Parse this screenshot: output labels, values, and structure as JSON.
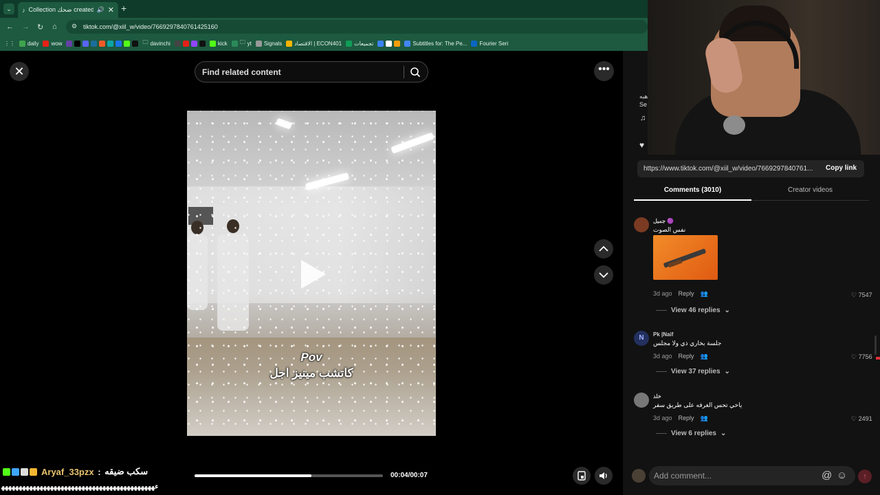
{
  "browser": {
    "tab_title": "Collection ضحك created by",
    "url": "tiktok.com/@xiil_w/video/7669297840761425160",
    "bookmarks": [
      "daily",
      "wow",
      "davinchi",
      "kick",
      "yt",
      "Signals",
      "الاقتصاد | ECON401",
      "تجميعات",
      "Subtitles for: The Pe...",
      "Fourier Seri"
    ]
  },
  "search": {
    "placeholder": "Find related content"
  },
  "video": {
    "caption_line1": "Pov",
    "caption_line2": "كاتشب مينيز اجل",
    "timecode": "00:04/00:07",
    "progress": 0.62
  },
  "panel": {
    "partial_author_fragment": "هبه",
    "partial_sub_fragment": "Se",
    "share_url": "https://www.tiktok.com/@xiil_w/video/7669297840761...",
    "copy_link": "Copy link",
    "tabs": {
      "comments": "Comments (3010)",
      "creator": "Creator videos"
    }
  },
  "comments": [
    {
      "name": "جميل 🟣",
      "text": "نفس الصوت",
      "time": "3d ago",
      "reply": "Reply",
      "likes": "7547",
      "replies": "View 46 replies",
      "sticker": true
    },
    {
      "name": "Pk |Naif",
      "text": "جلسة بخاري ذي ولا مجلس",
      "time": "3d ago",
      "reply": "Reply",
      "likes": "7756",
      "replies": "View 37 replies"
    },
    {
      "name": "خلد",
      "text": "ياخي تحس الغرفه على طريق سفر",
      "time": "3d ago",
      "reply": "Reply",
      "likes": "2491",
      "replies": "View 6 replies"
    }
  ],
  "add_comment": {
    "placeholder": "Add comment..."
  },
  "stream_chat": {
    "user": "Aryaf_33pzx",
    "message": "سكب ضيقه",
    "line2": "ﺀﻬﻬﻬﻬﻬﻬﻬﻬﻬﻬﻬﻬﻬﻬﻬﻬﻬﻬﻬﻬﻬﻬﻬﻬﻬﻬﻬﻬﻬﻬﻬﻬﻬﻬﻬﻬﻬﻬﻬﻬﻬﻬﻬﻬ"
  }
}
